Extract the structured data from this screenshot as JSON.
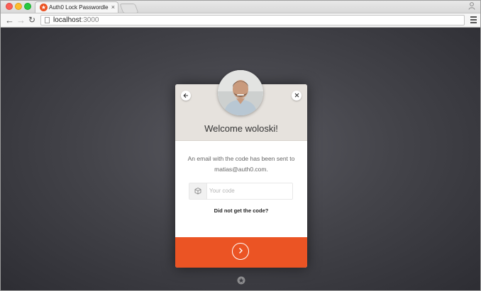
{
  "browser": {
    "tab_title": "Auth0 Lock Passwordless",
    "tab_close": "×",
    "url_host": "localhost",
    "url_port": ":3000"
  },
  "lock": {
    "welcome_text": "Welcome woloski!",
    "message_line1": "An email with the code has been sent to",
    "message_line2": "matias@auth0.com.",
    "code_placeholder": "Your code",
    "resend_link": "Did not get the code?"
  },
  "colors": {
    "accent": "#eb5424",
    "header_bg": "#e6e2dd",
    "page_bg": "#3c3c42"
  },
  "icons": {
    "back": "arrow-left-icon",
    "close": "close-icon",
    "code_field": "cube-icon",
    "submit": "chevron-right-icon",
    "footer": "auth0-badge-icon"
  }
}
